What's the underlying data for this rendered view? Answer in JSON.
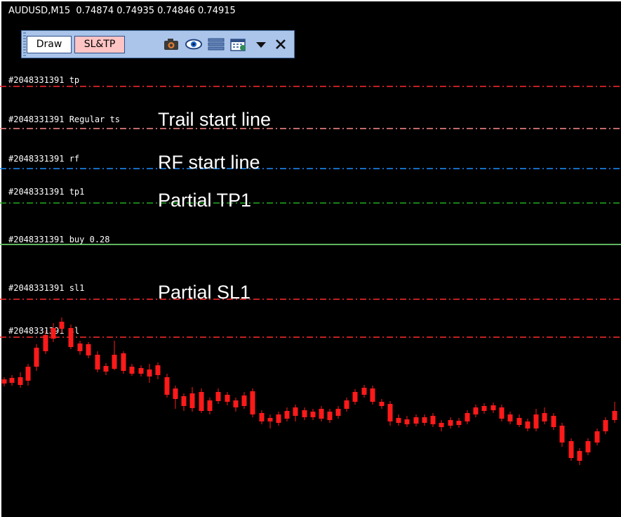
{
  "chart": {
    "symbol": "AUDUSD,M15",
    "ohlc": "0.74874 0.74935 0.74846 0.74915"
  },
  "toolbar": {
    "draw_label": "Draw",
    "sltp_label": "SL&TP",
    "icons": [
      "camera-icon",
      "eye-icon",
      "list-icon",
      "calendar-icon",
      "chevron-down-icon",
      "close-icon"
    ]
  },
  "lines": [
    {
      "key": "tp",
      "label": "#2048331391 tp",
      "color": "#ff2a2a"
    },
    {
      "key": "ts",
      "label": "#2048331391 Regular ts",
      "color": "#ff8c8c"
    },
    {
      "key": "rf",
      "label": "#2048331391 rf",
      "color": "#1e90ff"
    },
    {
      "key": "tp1",
      "label": "#2048331391 tp1",
      "color": "#22aa22"
    },
    {
      "key": "buy",
      "label": "#2048331391 buy 0.28",
      "color": "#6bcf6b"
    },
    {
      "key": "sl1",
      "label": "#2048331391 sl1",
      "color": "#ff2a2a"
    },
    {
      "key": "sl",
      "label": "#2048331391 sl",
      "color": "#ff2a2a"
    }
  ],
  "annotations": {
    "trail": "Trail start line",
    "rf": "RF start line",
    "tp1": "Partial TP1",
    "sl1": "Partial SL1"
  },
  "colors": {
    "bull": "#1ea8ff",
    "bear": "#ff1a1a",
    "background": "#000000"
  }
}
